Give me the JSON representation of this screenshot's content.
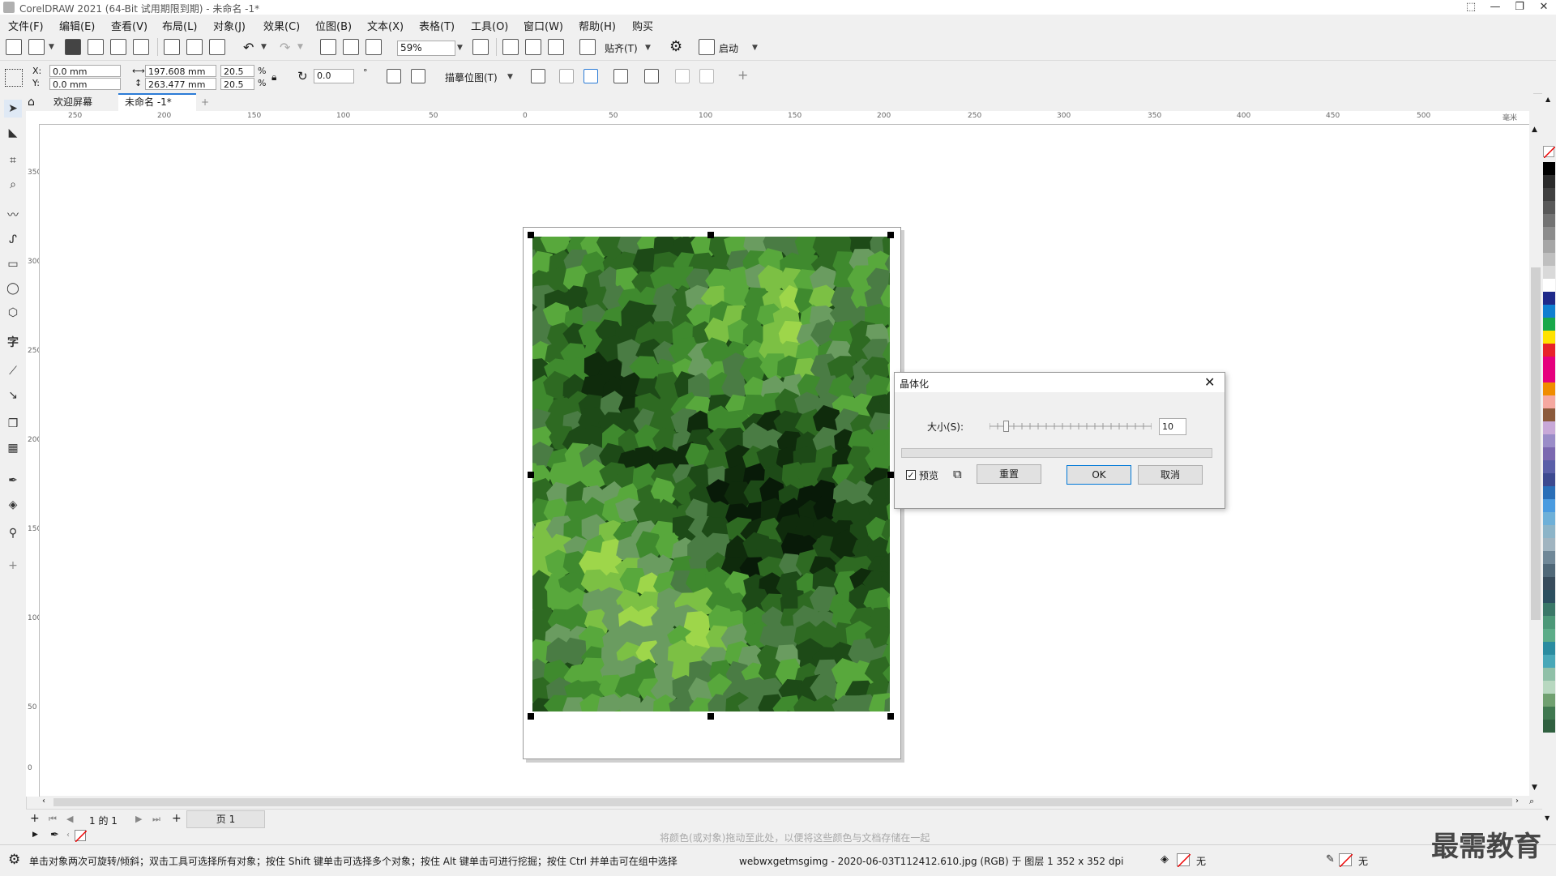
{
  "window": {
    "title": "CorelDRAW 2021 (64-Bit 试用期限到期) - 未命名 -1*",
    "minimize": "—",
    "restore": "❐",
    "close": "✕"
  },
  "menu": {
    "items": [
      "文件(F)",
      "编辑(E)",
      "查看(V)",
      "布局(L)",
      "对象(J)",
      "效果(C)",
      "位图(B)",
      "文本(X)",
      "表格(T)",
      "工具(O)",
      "窗口(W)",
      "帮助(H)",
      "购买"
    ]
  },
  "toolbar": {
    "zoom_value": "59%",
    "snap_label": "贴齐(T)",
    "launch_label": "启动"
  },
  "property_bar": {
    "x_label": "X:",
    "y_label": "Y:",
    "x_value": "0.0 mm",
    "y_value": "0.0 mm",
    "width_value": "197.608 mm",
    "height_value": "263.477 mm",
    "scale_w": "20.5",
    "scale_h": "20.5",
    "percent": "%",
    "rotation": "0.0",
    "degree": "°",
    "trace_label": "描摹位图(T)"
  },
  "tabs": {
    "welcome": "欢迎屏幕",
    "document": "未命名 -1*",
    "add": "+"
  },
  "rulers": {
    "h_ticks": [
      "250",
      "200",
      "150",
      "100",
      "50",
      "0",
      "50",
      "100",
      "150",
      "200",
      "250",
      "300",
      "350",
      "400",
      "450",
      "500"
    ],
    "v_ticks": [
      "350",
      "300",
      "250",
      "200",
      "150",
      "100",
      "50",
      "0"
    ],
    "unit": "毫米"
  },
  "dialog": {
    "title": "晶体化",
    "size_label": "大小(S):",
    "size_value": "10",
    "slider_level": 0.1,
    "preview_label": "预览",
    "reset_label": "重置",
    "ok_label": "OK",
    "cancel_label": "取消",
    "close": "✕"
  },
  "page_nav": {
    "page_info": "1 的 1",
    "page_tab": "页 1"
  },
  "colorbar": {
    "hint": "将颜色(或对象)拖动至此处，以便将这些颜色与文档存储在一起"
  },
  "status": {
    "hint": "单击对象两次可旋转/倾斜；双击工具可选择所有对象；按住 Shift 键单击可选择多个对象；按住 Alt 键单击可进行挖掘；按住 Ctrl 并单击可在组中选择",
    "object_info": "webwxgetmsgimg - 2020-06-03T112412.610.jpg (RGB) 于 图层 1 352 x 352 dpi",
    "fill_none": "无",
    "outline_none": "无"
  },
  "watermark": {
    "text": "最需教育"
  },
  "palette": {
    "colors": [
      "#000000",
      "#2b2b2b",
      "#404040",
      "#595959",
      "#737373",
      "#8c8c8c",
      "#a6a6a6",
      "#bfbfbf",
      "#d9d9d9",
      "#ffffff",
      "#1f2a8a",
      "#0f7fd0",
      "#19a84a",
      "#ffe200",
      "#e8222a",
      "#e5007d",
      "#e6007e",
      "#f08c00",
      "#f5a8a0",
      "#8b5a3c",
      "#c8a8d8",
      "#9a8cc8",
      "#7b68b0",
      "#5a5fa8",
      "#3d4a90",
      "#2a6fb8",
      "#4a9be0",
      "#6eb0d8",
      "#8cb4c8",
      "#a0b4c0",
      "#708898",
      "#506878",
      "#384c5c",
      "#2c5060",
      "#3a7868",
      "#4c9878",
      "#5cac88",
      "#2a8ca0",
      "#48a8b8",
      "#90c0a8",
      "#b8d8c0",
      "#70a070",
      "#407850",
      "#306040"
    ]
  },
  "bitmap": {
    "accent_colors": [
      "#0f2b0c",
      "#1d4a17",
      "#2e6a22",
      "#3f8a2e",
      "#58a83c",
      "#7cc044",
      "#9ed64a",
      "#6a9c60",
      "#4a7c44",
      "#081a08"
    ]
  }
}
